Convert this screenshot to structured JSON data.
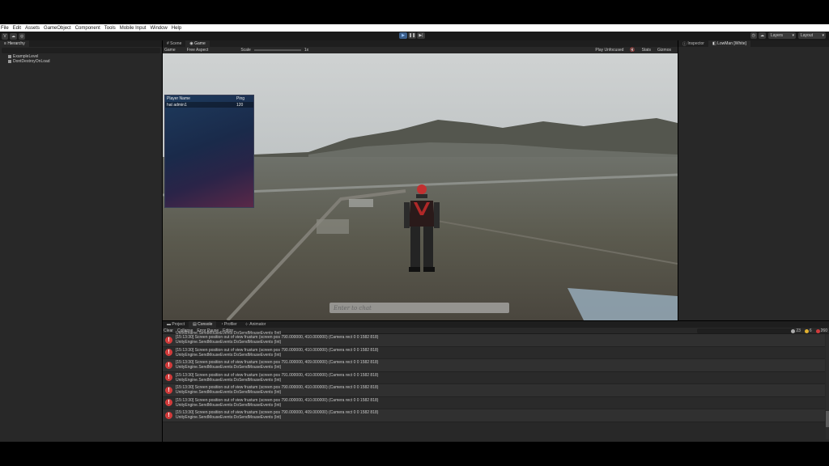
{
  "menu": [
    "File",
    "Edit",
    "Assets",
    "GameObject",
    "Component",
    "Tools",
    "Mobile Input",
    "Window",
    "Help"
  ],
  "toolbar": {
    "account_label": "V",
    "layers_label": "Layers",
    "layout_label": "Layout"
  },
  "hierarchy": {
    "tab_label": "Hierarchy",
    "search_placeholder": "All",
    "items": [
      "ExampleLevel",
      "DontDestroyOnLoad"
    ]
  },
  "game": {
    "tabs": [
      "Scene",
      "Game"
    ],
    "display_label": "Game",
    "aspect_label": "Free Aspect",
    "scale_label": "Scale",
    "scale_value": "1x",
    "play_mode": "Play Unfocused",
    "stats_label": "Stats",
    "gizmos_label": "Gizmos",
    "ping_table": {
      "headers": [
        "Player Name",
        "Ping"
      ],
      "rows": [
        {
          "name": "hat admin1",
          "ping": "120"
        }
      ]
    },
    "chat_placeholder": "Enter to chat"
  },
  "inspector": {
    "tabs": [
      "Inspector",
      "LowMan [White]"
    ]
  },
  "console": {
    "tabs": [
      "Project",
      "Console",
      "Profiler",
      "Animator"
    ],
    "toolbar": [
      "Clear",
      "Collapse",
      "Error Pause",
      "Editor"
    ],
    "counts": {
      "info": "23",
      "warn": "6",
      "error": "260"
    },
    "partial_line": "UnityEngine.SendMouseEvents:DoSendMouseEvents (Int)",
    "logs": [
      {
        "line1": "[15:13:30] Screen position out of view frustum (screen pos 790.000000, 410.000000) (Camera rect 0 0 1582 818)",
        "line2": "UnityEngine.SendMouseEvents:DoSendMouseEvents (Int)"
      },
      {
        "line1": "[15:13:30] Screen position out of view frustum (screen pos 790.000000, 410.000000) (Camera rect 0 0 1582 818)",
        "line2": "UnityEngine.SendMouseEvents:DoSendMouseEvents (Int)"
      },
      {
        "line1": "[15:13:30] Screen position out of view frustum (screen pos 791.000000, 409.000000) (Camera rect 0 0 1582 818)",
        "line2": "UnityEngine.SendMouseEvents:DoSendMouseEvents (Int)"
      },
      {
        "line1": "[15:13:30] Screen position out of view frustum (screen pos 791.000000, 410.000000) (Camera rect 0 0 1582 818)",
        "line2": "UnityEngine.SendMouseEvents:DoSendMouseEvents (Int)"
      },
      {
        "line1": "[15:13:30] Screen position out of view frustum (screen pos 790.000000, 410.000000) (Camera rect 0 0 1582 818)",
        "line2": "UnityEngine.SendMouseEvents:DoSendMouseEvents (Int)"
      },
      {
        "line1": "[15:13:30] Screen position out of view frustum (screen pos 790.000000, 410.000000) (Camera rect 0 0 1582 818)",
        "line2": "UnityEngine.SendMouseEvents:DoSendMouseEvents (Int)"
      },
      {
        "line1": "[15:13:30] Screen position out of view frustum (screen pos 790.000000, 409.000000) (Camera rect 0 0 1582 818)",
        "line2": "UnityEngine.SendMouseEvents:DoSendMouseEvents (Int)"
      }
    ]
  }
}
